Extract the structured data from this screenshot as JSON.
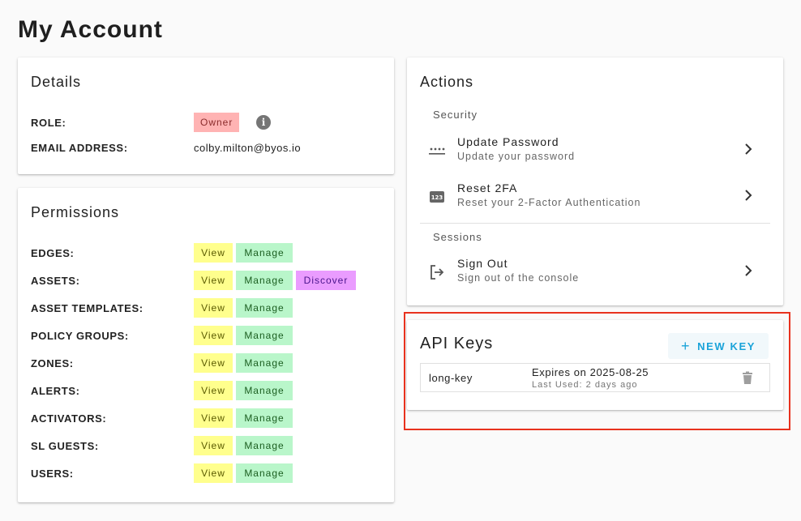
{
  "page": {
    "title": "My Account"
  },
  "details": {
    "title": "Details",
    "role_label": "ROLE:",
    "role_value": "Owner",
    "email_label": "EMAIL ADDRESS:",
    "email_value": "colby.milton@byos.io"
  },
  "permissions": {
    "title": "Permissions",
    "rows": [
      {
        "label": "EDGES:",
        "chips": [
          "View",
          "Manage"
        ]
      },
      {
        "label": "ASSETS:",
        "chips": [
          "View",
          "Manage",
          "Discover"
        ]
      },
      {
        "label": "ASSET TEMPLATES:",
        "chips": [
          "View",
          "Manage"
        ]
      },
      {
        "label": "POLICY GROUPS:",
        "chips": [
          "View",
          "Manage"
        ]
      },
      {
        "label": "ZONES:",
        "chips": [
          "View",
          "Manage"
        ]
      },
      {
        "label": "ALERTS:",
        "chips": [
          "View",
          "Manage"
        ]
      },
      {
        "label": "ACTIVATORS:",
        "chips": [
          "View",
          "Manage"
        ]
      },
      {
        "label": "SL GUESTS:",
        "chips": [
          "View",
          "Manage"
        ]
      },
      {
        "label": "USERS:",
        "chips": [
          "View",
          "Manage"
        ]
      }
    ]
  },
  "actions": {
    "title": "Actions",
    "security_label": "Security",
    "sessions_label": "Sessions",
    "update_password": {
      "title": "Update Password",
      "subtitle": "Update your password",
      "icon": "password-dots-icon"
    },
    "reset_2fa": {
      "title": "Reset 2FA",
      "subtitle": "Reset your 2-Factor Authentication",
      "icon": "pin-123-icon"
    },
    "sign_out": {
      "title": "Sign Out",
      "subtitle": "Sign out of the console",
      "icon": "logout-icon"
    }
  },
  "api_keys": {
    "title": "API Keys",
    "new_key_label": "NEW KEY",
    "keys": [
      {
        "name": "long-key",
        "expires": "Expires on 2025-08-25",
        "last_used": "Last Used: 2 days ago"
      }
    ]
  },
  "colors": {
    "accent": "#1aa3d9",
    "highlight": "#e8321e",
    "role_chip": "#ffb3b3",
    "view_chip": "#ffff8d",
    "manage_chip": "#b9f6ca",
    "discover_chip": "#ea9cff"
  }
}
